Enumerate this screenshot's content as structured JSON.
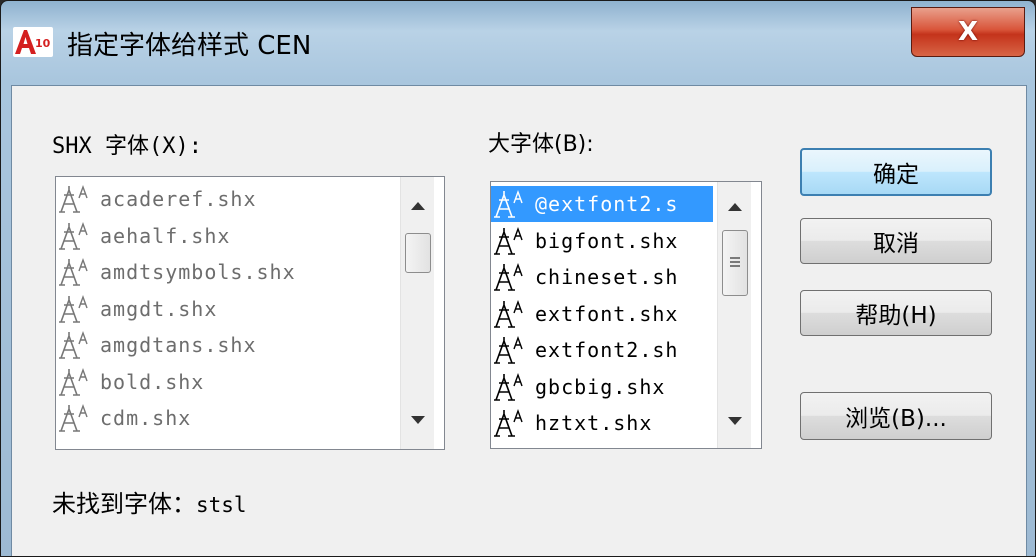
{
  "window": {
    "app_icon_label": "A10",
    "title": "指定字体给样式 CEN",
    "close_label": "X"
  },
  "shx_fonts": {
    "label": "SHX 字体(X):",
    "items": [
      "acaderef.shx",
      "aehalf.shx",
      "amdtsymbols.shx",
      "amgdt.shx",
      "amgdtans.shx",
      "bold.shx",
      "cdm.shx"
    ]
  },
  "big_fonts": {
    "label": "大字体(B):",
    "items": [
      "@extfont2.s",
      "bigfont.shx",
      "chineset.sh",
      "extfont.shx",
      "extfont2.sh",
      "gbcbig.shx",
      "hztxt.shx"
    ],
    "selected_index": 0
  },
  "buttons": {
    "ok": "确定",
    "cancel": "取消",
    "help": "帮助(H)",
    "browse": "浏览(B)..."
  },
  "status": {
    "label": "未找到字体：",
    "font_name": "stsl"
  },
  "colors": {
    "selection": "#3399ff",
    "close_button": "#c4331b"
  }
}
